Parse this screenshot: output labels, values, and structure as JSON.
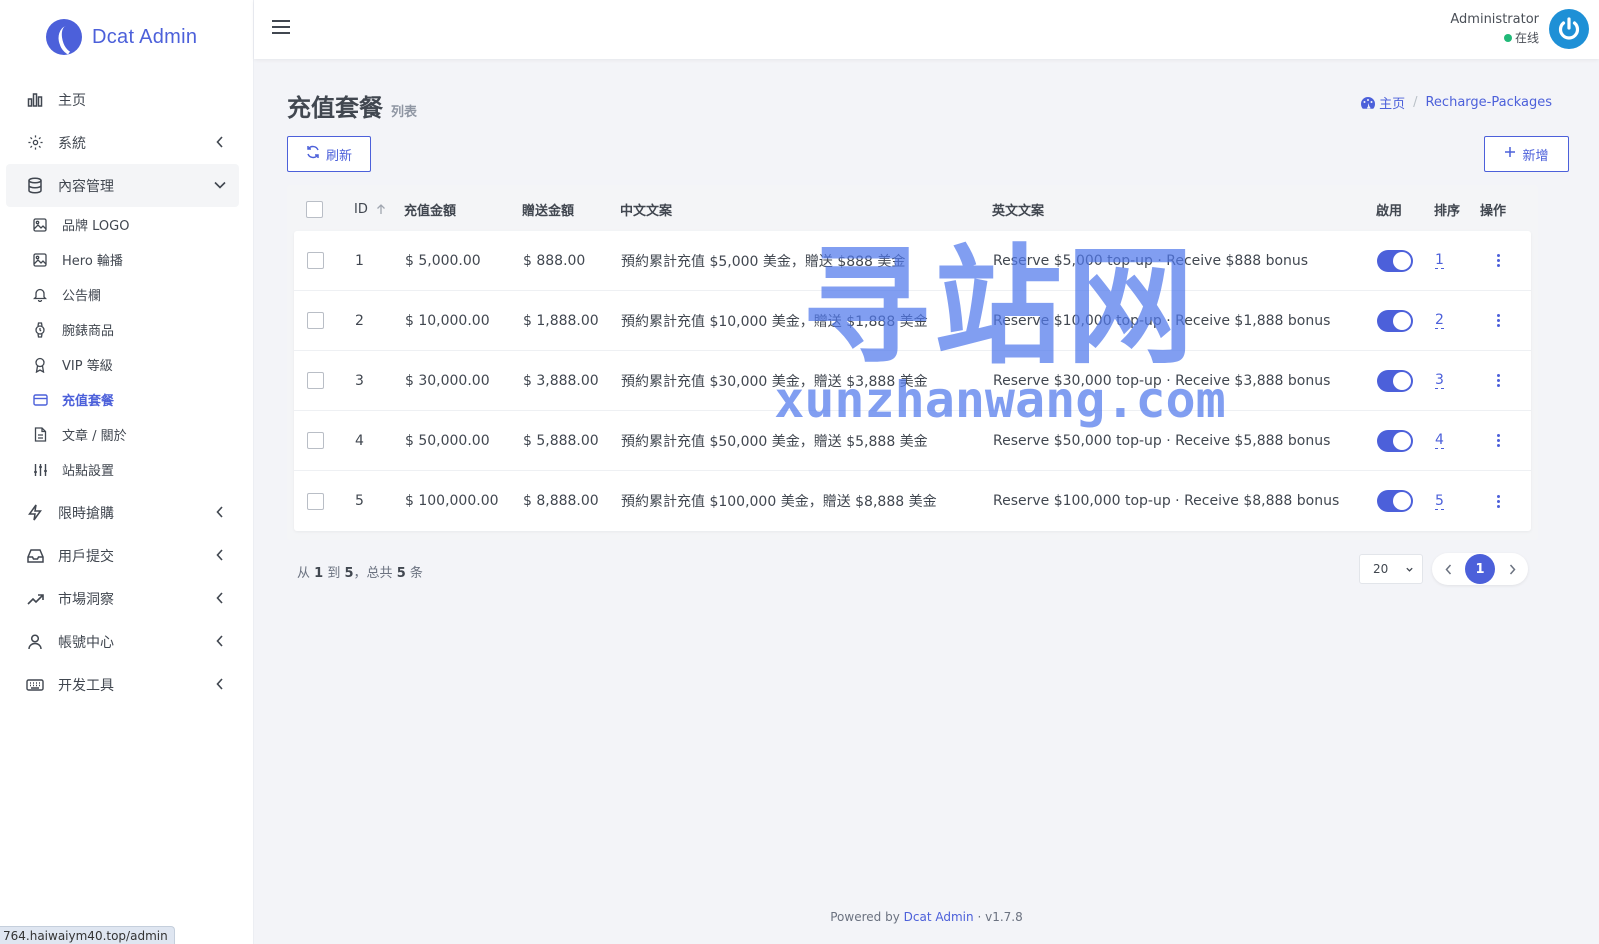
{
  "brand": {
    "name": "Dcat Admin"
  },
  "sidebar": {
    "items": [
      {
        "label": "主页",
        "icon": "bar-chart-icon"
      },
      {
        "label": "系統",
        "icon": "gear-icon"
      },
      {
        "label": "內容管理",
        "icon": "database-icon"
      },
      {
        "label": "限時搶購",
        "icon": "lightning-icon"
      },
      {
        "label": "用戶提交",
        "icon": "inbox-icon"
      },
      {
        "label": "市場洞察",
        "icon": "trending-up-icon"
      },
      {
        "label": "帳號中心",
        "icon": "user-icon"
      },
      {
        "label": "开发工具",
        "icon": "keyboard-icon"
      }
    ],
    "subitems": [
      {
        "label": "品牌 LOGO",
        "icon": "image-icon"
      },
      {
        "label": "Hero 輪播",
        "icon": "image-icon"
      },
      {
        "label": "公告欄",
        "icon": "bell-icon"
      },
      {
        "label": "腕錶商品",
        "icon": "watch-icon"
      },
      {
        "label": "VIP 等級",
        "icon": "award-icon"
      },
      {
        "label": "充值套餐",
        "icon": "credit-card-icon"
      },
      {
        "label": "文章 / 關於",
        "icon": "file-text-icon"
      },
      {
        "label": "站點設置",
        "icon": "sliders-icon"
      }
    ]
  },
  "header": {
    "user_name": "Administrator",
    "user_status": "在线"
  },
  "page": {
    "title": "充值套餐",
    "subtitle": "列表",
    "breadcrumb": {
      "home": "主页",
      "current": "Recharge-Packages"
    },
    "refresh_label": "刷新",
    "add_label": "新增"
  },
  "table": {
    "headers": {
      "id": "ID",
      "amount": "充值金額",
      "bonus": "贈送金額",
      "zh": "中文文案",
      "en": "英文文案",
      "enabled": "啟用",
      "order": "排序",
      "actions": "操作"
    },
    "rows": [
      {
        "id": "1",
        "amount": "$ 5,000.00",
        "bonus": "$ 888.00",
        "zh": "預約累計充值 $5,000 美金，贈送 $888 美金",
        "en": "Reserve $5,000 top-up · Receive $888 bonus",
        "enabled": true,
        "order": "1"
      },
      {
        "id": "2",
        "amount": "$ 10,000.00",
        "bonus": "$ 1,888.00",
        "zh": "預約累計充值 $10,000 美金，贈送 $1,888 美金",
        "en": "Reserve $10,000 top-up · Receive $1,888 bonus",
        "enabled": true,
        "order": "2"
      },
      {
        "id": "3",
        "amount": "$ 30,000.00",
        "bonus": "$ 3,888.00",
        "zh": "預約累計充值 $30,000 美金，贈送 $3,888 美金",
        "en": "Reserve $30,000 top-up · Receive $3,888 bonus",
        "enabled": true,
        "order": "3"
      },
      {
        "id": "4",
        "amount": "$ 50,000.00",
        "bonus": "$ 5,888.00",
        "zh": "預約累計充值 $50,000 美金，贈送 $5,888 美金",
        "en": "Reserve $50,000 top-up · Receive $5,888 bonus",
        "enabled": true,
        "order": "4"
      },
      {
        "id": "5",
        "amount": "$ 100,000.00",
        "bonus": "$ 8,888.00",
        "zh": "預約累計充值 $100,000 美金，贈送 $8,888 美金",
        "en": "Reserve $100,000 top-up · Receive $8,888 bonus",
        "enabled": true,
        "order": "5"
      }
    ]
  },
  "pager": {
    "prefix": "从",
    "from": "1",
    "to_word": "到",
    "to": "5",
    "total_word": "，总共",
    "total": "5",
    "suffix": "条",
    "per_page": "20",
    "current_page": "1"
  },
  "footer": {
    "powered_by": "Powered by",
    "link": "Dcat Admin",
    "sep": "·",
    "version": "v1.7.8"
  },
  "status_bar": {
    "url": "764.haiwaiym40.top/admin"
  },
  "watermark": {
    "main": "寻站网",
    "sub": "xunzhanwang.com"
  },
  "colors": {
    "accent": "#4c60da",
    "online": "#21b978",
    "avatar": "#1e90d6"
  }
}
